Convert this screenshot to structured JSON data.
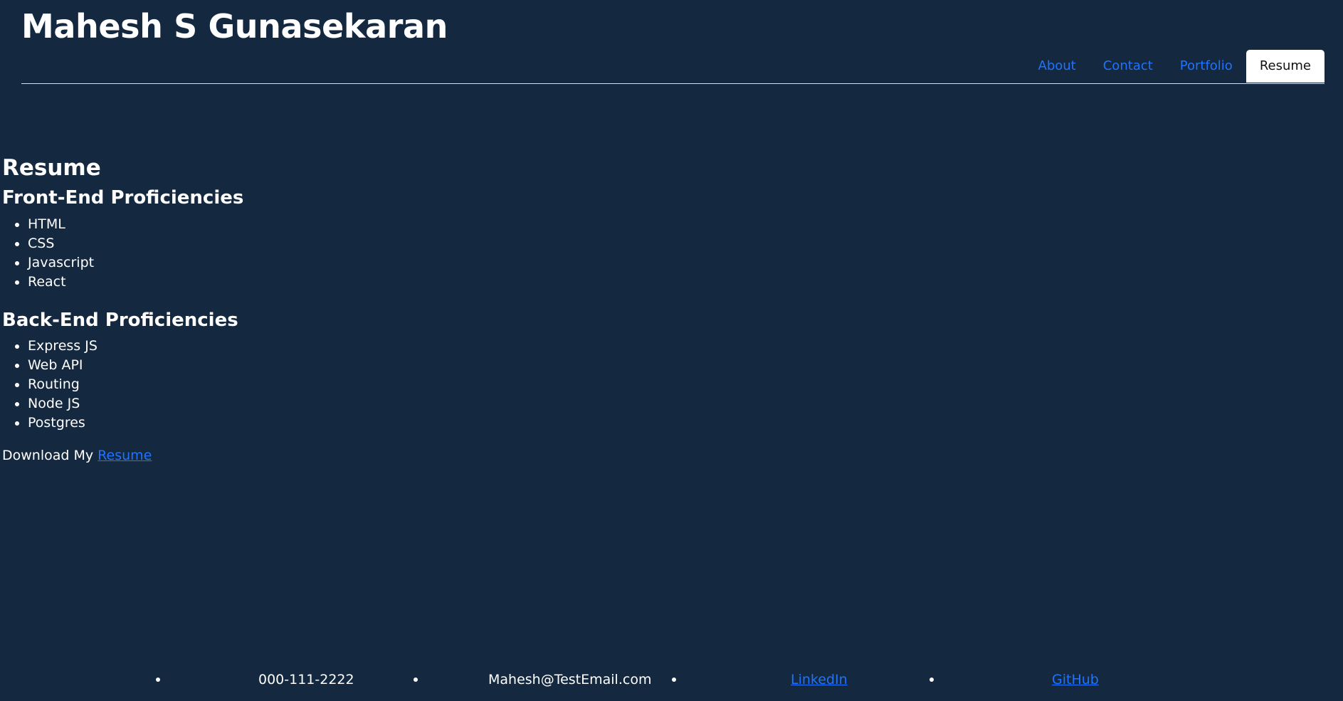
{
  "header": {
    "title": "Mahesh S Gunasekaran",
    "nav": [
      {
        "label": "About"
      },
      {
        "label": "Contact"
      },
      {
        "label": "Portfolio"
      },
      {
        "label": "Resume"
      }
    ]
  },
  "main": {
    "heading": "Resume",
    "frontend": {
      "title": "Front-End Proficiencies",
      "items": [
        "HTML",
        "CSS",
        "Javascript",
        "React"
      ]
    },
    "backend": {
      "title": "Back-End Proficiencies",
      "items": [
        "Express JS",
        "Web API",
        "Routing",
        "Node JS",
        "Postgres"
      ]
    },
    "download": {
      "text": "Download My",
      "link_label": "Resume"
    }
  },
  "footer": {
    "phone": "000-111-2222",
    "email": "Mahesh@TestEmail.com",
    "linkedin_label": "LinkedIn",
    "github_label": "GitHub"
  },
  "colors": {
    "background": "#14283f",
    "link": "#1f74ff",
    "active_tab_bg": "#ffffff",
    "text": "#ffffff"
  }
}
